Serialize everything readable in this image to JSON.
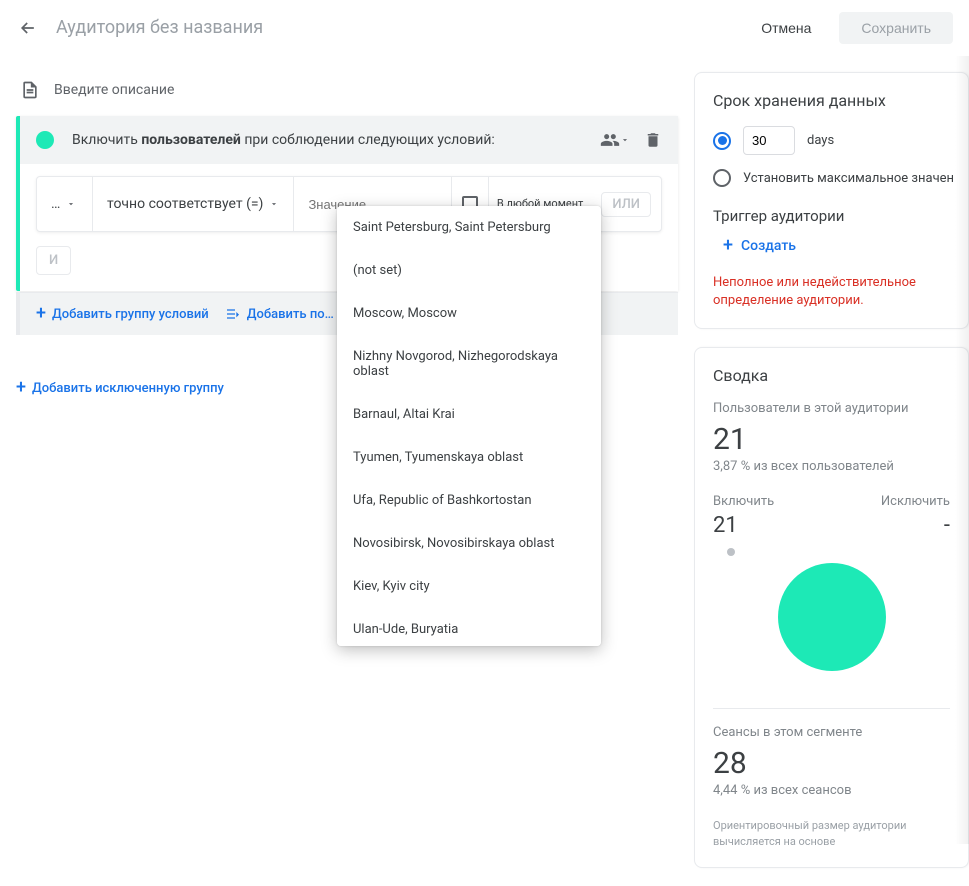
{
  "header": {
    "title": "Аудитория без названия",
    "cancel": "Отмена",
    "save": "Сохранить"
  },
  "description_placeholder": "Введите описание",
  "condition": {
    "prefix": "Включить ",
    "bold": "пользователей",
    "suffix": " при соблюдении следующих условий:",
    "selector_ellipsis": "…",
    "match": "точно соответствует (=)",
    "value_placeholder": "Значение",
    "any_moment": "В любой момент",
    "or": "ИЛИ",
    "and": "И"
  },
  "group_actions": {
    "add_group": "Добавить группу условий",
    "add_seq": "Добавить по…"
  },
  "add_excluded": "Добавить исключенную группу",
  "dropdown_options": [
    "Saint Petersburg, Saint Petersburg",
    "(not set)",
    "Moscow, Moscow",
    "Nizhny Novgorod, Nizhegorodskaya oblast",
    "Barnaul, Altai Krai",
    "Tyumen, Tyumenskaya oblast",
    "Ufa, Republic of Bashkortostan",
    "Novosibirsk, Novosibirskaya oblast",
    "Kiev, Kyiv city",
    "Ulan-Ude, Buryatia"
  ],
  "retention": {
    "title": "Срок хранения данных",
    "days_value": "30",
    "days_label": "days",
    "set_max": "Установить максимальное значен"
  },
  "trigger": {
    "title": "Триггер аудитории",
    "create": "Создать"
  },
  "error": "Неполное или недействительное определение аудитории.",
  "summary": {
    "title": "Сводка",
    "users_label": "Пользователи в этой аудитории",
    "users_value": "21",
    "users_pct": "3,87 % из всех пользователей",
    "include": "Включить",
    "exclude": "Исключить",
    "include_val": "21",
    "exclude_val": "-",
    "sessions_label": "Сеансы в этом сегменте",
    "sessions_value": "28",
    "sessions_pct": "4,44 % из всех сеансов",
    "footnote": "Ориентировочный размер аудитории вычисляется на основе"
  },
  "chart_data": {
    "type": "pie",
    "title": "",
    "series": [
      {
        "name": "Включить",
        "value": 21,
        "color": "#1de9b6"
      },
      {
        "name": "Исключить",
        "value": 0,
        "color": "#bdc1c6"
      }
    ]
  }
}
